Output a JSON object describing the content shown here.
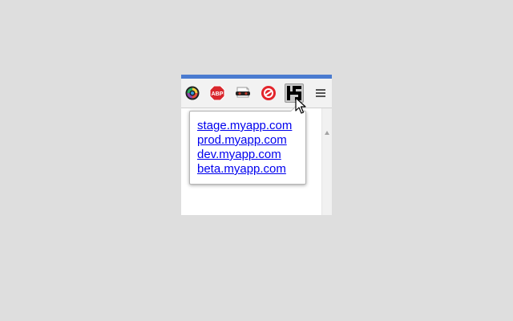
{
  "window": {
    "accent_color": "#4a7bd0"
  },
  "toolbar": {
    "extensions": [
      {
        "name": "color-picker",
        "icon": "color-wheel-icon"
      },
      {
        "name": "adblock-plus",
        "icon": "abp-icon",
        "label": "ABP"
      },
      {
        "name": "incognito",
        "icon": "mask-icon"
      },
      {
        "name": "lastpass",
        "icon": "red-circle-icon"
      },
      {
        "name": "hostname-switcher",
        "icon": "hs-icon",
        "active": true
      }
    ],
    "menu_icon": "hamburger-menu-icon"
  },
  "popup": {
    "links": [
      "stage.myapp.com",
      "prod.myapp.com",
      "dev.myapp.com",
      "beta.myapp.com"
    ],
    "link_color": "#0000ee"
  },
  "colors": {
    "abp_red": "#d9262c",
    "lastpass_red": "#e3242b",
    "page_bg": "#dedede"
  }
}
